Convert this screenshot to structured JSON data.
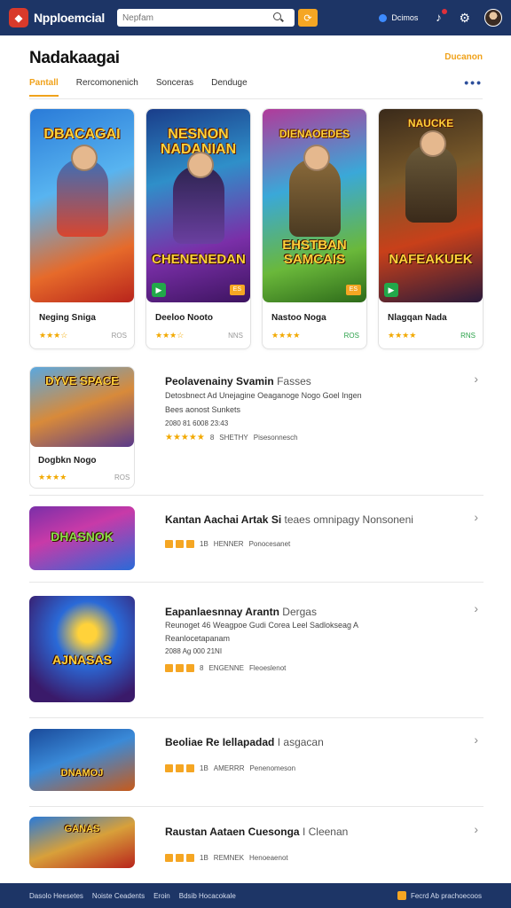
{
  "topbar": {
    "brand": "Npploemcial",
    "search_placeholder": "Nepfam",
    "user_label": "Dcimos"
  },
  "header": {
    "title": "Nadakaagai",
    "see_all": "Ducanon",
    "tabs": [
      "Pantall",
      "Rercomonenich",
      "Sonceras",
      "Denduge"
    ]
  },
  "featured": [
    {
      "art_top": "DBACAGAI",
      "art_bottom": "",
      "name": "Neging Sniga",
      "stars": "★★★☆",
      "score": "ROS",
      "score_green": false,
      "badge": "",
      "play": false
    },
    {
      "art_top": "NESNON NADANIAN",
      "art_bottom": "CHENENEDAN",
      "name": "Deeloo Nooto",
      "stars": "★★★☆",
      "score": "NNS",
      "score_green": false,
      "badge": "ES",
      "play": true
    },
    {
      "art_top": "DIENAOEDES",
      "art_bottom": "EHSTBAN SAMCAIS",
      "name": "Nastoo Noga",
      "stars": "★★★★",
      "score": "ROS",
      "score_green": true,
      "badge": "ES",
      "play": false
    },
    {
      "art_top": "NAUCKE",
      "art_bottom": "NAFEAKUEK",
      "name": "Nlagqan Nada",
      "stars": "★★★★",
      "score": "RNS",
      "score_green": true,
      "badge": "",
      "play": true
    }
  ],
  "list": [
    {
      "thumb": "DYVE SPACE",
      "card_name": "Dogbkn Nogo",
      "card_stars": "★★★★",
      "card_score": "ROS",
      "title": "Peolavenainy Svamin",
      "title_light": "Fasses",
      "desc1": "Detosbnect Ad Unejagine Oeaganoge Nogo Goel Ingen",
      "desc2": "Bees aonost Sunkets",
      "stats": "2080 81 6008  23:43",
      "stars": "★★★★★",
      "rating": "8",
      "meta1": "SHETHY",
      "meta2": "Pisesonnesch"
    },
    {
      "thumb": "DHASNOK",
      "title": "Kantan Aachai Artak Si",
      "title_light": "teaes omnipagy Nonsoneni",
      "stats": "1B",
      "meta1": "HENNER",
      "meta2": "Ponocesanet"
    },
    {
      "thumb": "AJNASAS",
      "title": "Eapanlaesnnay Arantn",
      "title_light": "Dergas",
      "desc1": "Reunoget 46 Weagpoe Gudi Corea Leel Sadlokseag A",
      "desc2": "Reanlocetapanam",
      "stats": "2088 Ag 000  21NI",
      "rating": "8",
      "meta1": "ENGENNE",
      "meta2": "Fleoeslenot"
    },
    {
      "thumb": "DNAMOJ",
      "title": "Beoliae Re Iellapadad",
      "title_light": "I asgacan",
      "stats": "1B",
      "meta1": "AMERRR",
      "meta2": "Penenomeson"
    },
    {
      "thumb": "GANAS",
      "title": "Raustan Aataen Cuesonga",
      "title_light": "I Cleenan",
      "stats": "1B",
      "meta1": "REMNEK",
      "meta2": "Henoeaenot"
    }
  ],
  "footer": {
    "links": [
      "Dasolo Heesetes",
      "Noiste Ceadents",
      "Eroin",
      "Bdsib Hocacokale"
    ],
    "right": "Fecrd Ab prachoecoos"
  },
  "colors": {
    "topbar": "#1d3566",
    "accent": "#f0a21b",
    "star": "#f2a900"
  }
}
